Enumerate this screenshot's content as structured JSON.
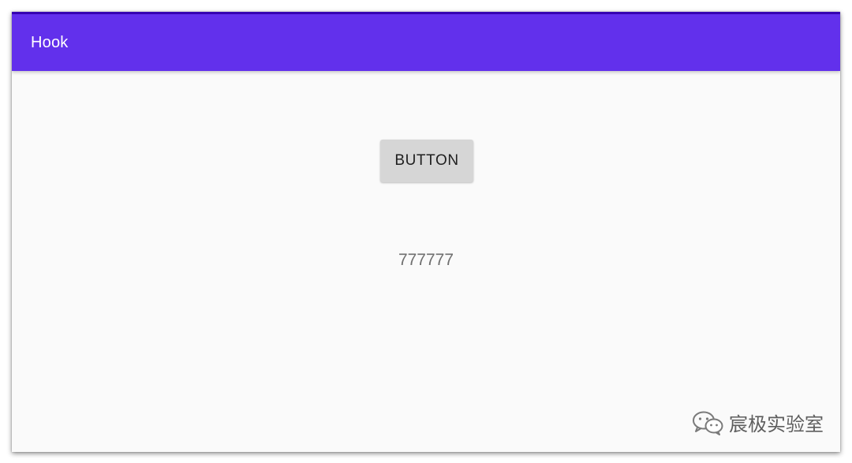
{
  "app": {
    "title": "Hook",
    "accent_color": "#6230ec",
    "status_color": "#3700b3"
  },
  "main": {
    "button_label": "BUTTON",
    "result_text": "777777"
  },
  "watermark": {
    "icon": "wechat-icon",
    "text": "宸极实验室"
  }
}
